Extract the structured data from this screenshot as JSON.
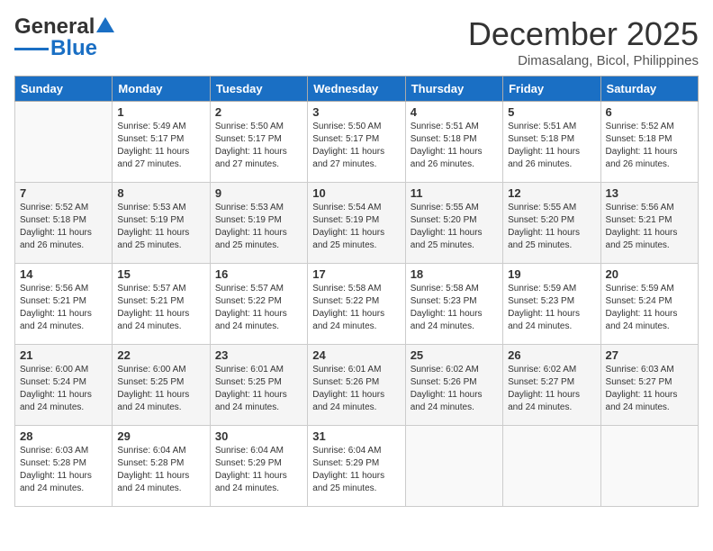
{
  "logo": {
    "general": "General",
    "blue": "Blue"
  },
  "title": "December 2025",
  "location": "Dimasalang, Bicol, Philippines",
  "weekdays": [
    "Sunday",
    "Monday",
    "Tuesday",
    "Wednesday",
    "Thursday",
    "Friday",
    "Saturday"
  ],
  "weeks": [
    [
      {
        "day": "",
        "sunrise": "",
        "sunset": "",
        "daylight": ""
      },
      {
        "day": "1",
        "sunrise": "Sunrise: 5:49 AM",
        "sunset": "Sunset: 5:17 PM",
        "daylight": "Daylight: 11 hours and 27 minutes."
      },
      {
        "day": "2",
        "sunrise": "Sunrise: 5:50 AM",
        "sunset": "Sunset: 5:17 PM",
        "daylight": "Daylight: 11 hours and 27 minutes."
      },
      {
        "day": "3",
        "sunrise": "Sunrise: 5:50 AM",
        "sunset": "Sunset: 5:17 PM",
        "daylight": "Daylight: 11 hours and 27 minutes."
      },
      {
        "day": "4",
        "sunrise": "Sunrise: 5:51 AM",
        "sunset": "Sunset: 5:18 PM",
        "daylight": "Daylight: 11 hours and 26 minutes."
      },
      {
        "day": "5",
        "sunrise": "Sunrise: 5:51 AM",
        "sunset": "Sunset: 5:18 PM",
        "daylight": "Daylight: 11 hours and 26 minutes."
      },
      {
        "day": "6",
        "sunrise": "Sunrise: 5:52 AM",
        "sunset": "Sunset: 5:18 PM",
        "daylight": "Daylight: 11 hours and 26 minutes."
      }
    ],
    [
      {
        "day": "7",
        "sunrise": "Sunrise: 5:52 AM",
        "sunset": "Sunset: 5:18 PM",
        "daylight": "Daylight: 11 hours and 26 minutes."
      },
      {
        "day": "8",
        "sunrise": "Sunrise: 5:53 AM",
        "sunset": "Sunset: 5:19 PM",
        "daylight": "Daylight: 11 hours and 25 minutes."
      },
      {
        "day": "9",
        "sunrise": "Sunrise: 5:53 AM",
        "sunset": "Sunset: 5:19 PM",
        "daylight": "Daylight: 11 hours and 25 minutes."
      },
      {
        "day": "10",
        "sunrise": "Sunrise: 5:54 AM",
        "sunset": "Sunset: 5:19 PM",
        "daylight": "Daylight: 11 hours and 25 minutes."
      },
      {
        "day": "11",
        "sunrise": "Sunrise: 5:55 AM",
        "sunset": "Sunset: 5:20 PM",
        "daylight": "Daylight: 11 hours and 25 minutes."
      },
      {
        "day": "12",
        "sunrise": "Sunrise: 5:55 AM",
        "sunset": "Sunset: 5:20 PM",
        "daylight": "Daylight: 11 hours and 25 minutes."
      },
      {
        "day": "13",
        "sunrise": "Sunrise: 5:56 AM",
        "sunset": "Sunset: 5:21 PM",
        "daylight": "Daylight: 11 hours and 25 minutes."
      }
    ],
    [
      {
        "day": "14",
        "sunrise": "Sunrise: 5:56 AM",
        "sunset": "Sunset: 5:21 PM",
        "daylight": "Daylight: 11 hours and 24 minutes."
      },
      {
        "day": "15",
        "sunrise": "Sunrise: 5:57 AM",
        "sunset": "Sunset: 5:21 PM",
        "daylight": "Daylight: 11 hours and 24 minutes."
      },
      {
        "day": "16",
        "sunrise": "Sunrise: 5:57 AM",
        "sunset": "Sunset: 5:22 PM",
        "daylight": "Daylight: 11 hours and 24 minutes."
      },
      {
        "day": "17",
        "sunrise": "Sunrise: 5:58 AM",
        "sunset": "Sunset: 5:22 PM",
        "daylight": "Daylight: 11 hours and 24 minutes."
      },
      {
        "day": "18",
        "sunrise": "Sunrise: 5:58 AM",
        "sunset": "Sunset: 5:23 PM",
        "daylight": "Daylight: 11 hours and 24 minutes."
      },
      {
        "day": "19",
        "sunrise": "Sunrise: 5:59 AM",
        "sunset": "Sunset: 5:23 PM",
        "daylight": "Daylight: 11 hours and 24 minutes."
      },
      {
        "day": "20",
        "sunrise": "Sunrise: 5:59 AM",
        "sunset": "Sunset: 5:24 PM",
        "daylight": "Daylight: 11 hours and 24 minutes."
      }
    ],
    [
      {
        "day": "21",
        "sunrise": "Sunrise: 6:00 AM",
        "sunset": "Sunset: 5:24 PM",
        "daylight": "Daylight: 11 hours and 24 minutes."
      },
      {
        "day": "22",
        "sunrise": "Sunrise: 6:00 AM",
        "sunset": "Sunset: 5:25 PM",
        "daylight": "Daylight: 11 hours and 24 minutes."
      },
      {
        "day": "23",
        "sunrise": "Sunrise: 6:01 AM",
        "sunset": "Sunset: 5:25 PM",
        "daylight": "Daylight: 11 hours and 24 minutes."
      },
      {
        "day": "24",
        "sunrise": "Sunrise: 6:01 AM",
        "sunset": "Sunset: 5:26 PM",
        "daylight": "Daylight: 11 hours and 24 minutes."
      },
      {
        "day": "25",
        "sunrise": "Sunrise: 6:02 AM",
        "sunset": "Sunset: 5:26 PM",
        "daylight": "Daylight: 11 hours and 24 minutes."
      },
      {
        "day": "26",
        "sunrise": "Sunrise: 6:02 AM",
        "sunset": "Sunset: 5:27 PM",
        "daylight": "Daylight: 11 hours and 24 minutes."
      },
      {
        "day": "27",
        "sunrise": "Sunrise: 6:03 AM",
        "sunset": "Sunset: 5:27 PM",
        "daylight": "Daylight: 11 hours and 24 minutes."
      }
    ],
    [
      {
        "day": "28",
        "sunrise": "Sunrise: 6:03 AM",
        "sunset": "Sunset: 5:28 PM",
        "daylight": "Daylight: 11 hours and 24 minutes."
      },
      {
        "day": "29",
        "sunrise": "Sunrise: 6:04 AM",
        "sunset": "Sunset: 5:28 PM",
        "daylight": "Daylight: 11 hours and 24 minutes."
      },
      {
        "day": "30",
        "sunrise": "Sunrise: 6:04 AM",
        "sunset": "Sunset: 5:29 PM",
        "daylight": "Daylight: 11 hours and 24 minutes."
      },
      {
        "day": "31",
        "sunrise": "Sunrise: 6:04 AM",
        "sunset": "Sunset: 5:29 PM",
        "daylight": "Daylight: 11 hours and 25 minutes."
      },
      {
        "day": "",
        "sunrise": "",
        "sunset": "",
        "daylight": ""
      },
      {
        "day": "",
        "sunrise": "",
        "sunset": "",
        "daylight": ""
      },
      {
        "day": "",
        "sunrise": "",
        "sunset": "",
        "daylight": ""
      }
    ]
  ]
}
